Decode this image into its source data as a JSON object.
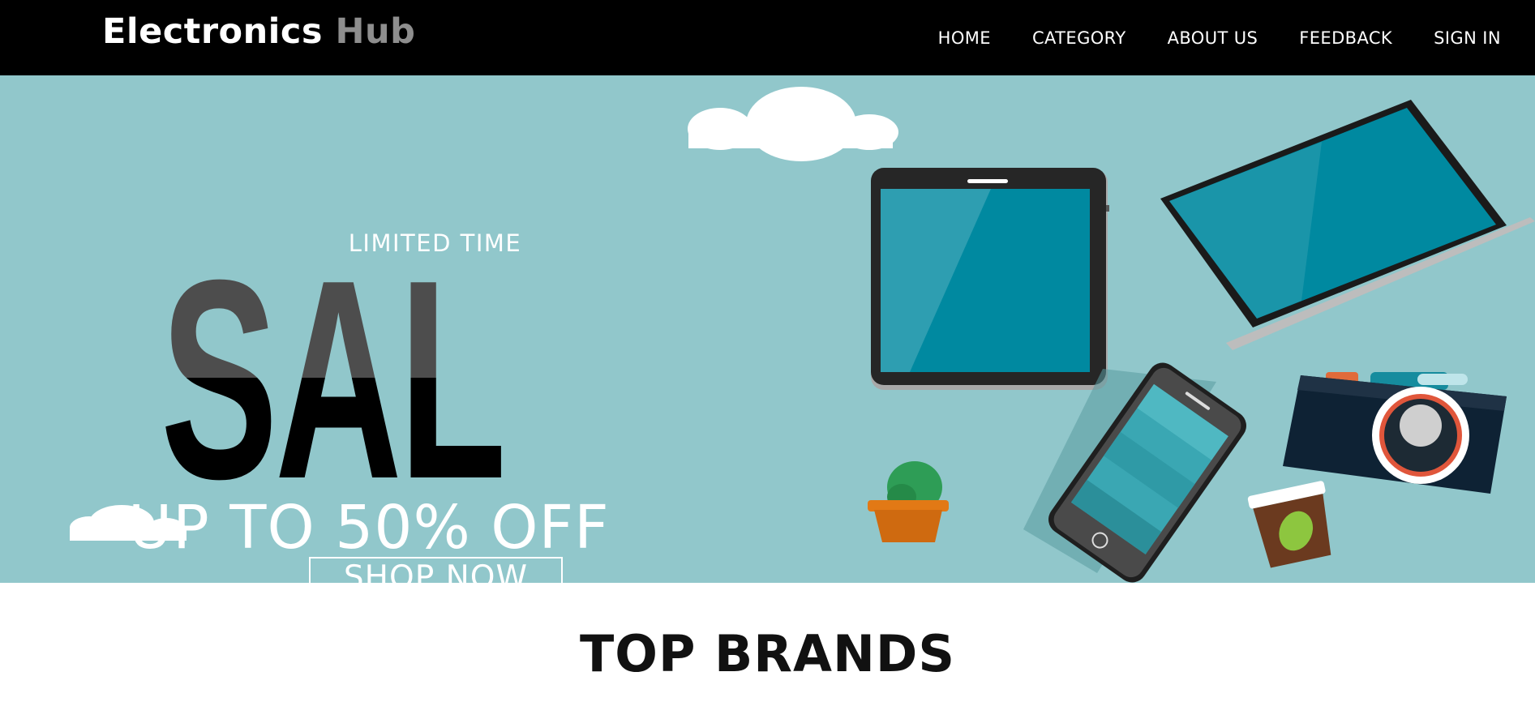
{
  "brand": {
    "part1": "Electronics",
    "part2": "Hub"
  },
  "nav": {
    "items": [
      {
        "label": "HOME"
      },
      {
        "label": "CATEGORY"
      },
      {
        "label": "ABOUT US"
      },
      {
        "label": "FEEDBACK"
      },
      {
        "label": "SIGN IN"
      }
    ]
  },
  "banner": {
    "limited_time": "LIMITED TIME",
    "headline": "SALE",
    "offer": "UP TO 50% OFF",
    "cta": "SHOP NOW"
  },
  "sections": {
    "top_brands": "TOP BRANDS"
  },
  "colors": {
    "navbar_bg": "#000000",
    "brand_accent": "#8e8e8e",
    "banner_bg": "#91c7cb",
    "device_screen": "#0089a0"
  }
}
